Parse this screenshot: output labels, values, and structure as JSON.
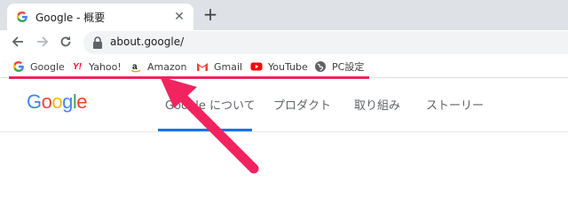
{
  "tab": {
    "title": "Google - 概要",
    "close_glyph": "✕"
  },
  "new_tab_glyph": "+",
  "toolbar": {
    "back_glyph": "←",
    "forward_glyph": "→",
    "reload_glyph": "↻",
    "url": "about.google/"
  },
  "bookmarks": [
    {
      "label": "Google",
      "icon": "google-icon"
    },
    {
      "label": "Yahoo!",
      "icon": "yahoo-icon"
    },
    {
      "label": "Amazon",
      "icon": "amazon-icon"
    },
    {
      "label": "Gmail",
      "icon": "gmail-icon"
    },
    {
      "label": "YouTube",
      "icon": "youtube-icon"
    },
    {
      "label": "PC設定",
      "icon": "pc-settings-icon"
    }
  ],
  "page": {
    "logo": [
      "G",
      "o",
      "o",
      "g",
      "l",
      "e"
    ],
    "nav": [
      "Google について",
      "プロダクト",
      "取り組み",
      "ストーリー"
    ]
  },
  "colors": {
    "highlight": "#f2245f",
    "active_tab": "#1a73e8"
  }
}
